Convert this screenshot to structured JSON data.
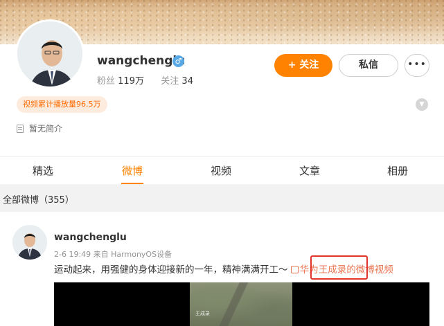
{
  "profile": {
    "username": "wangchenglu",
    "gender_icon": "male-icon",
    "fans_label": "粉丝",
    "fans_count": "119万",
    "following_label": "关注",
    "following_count": "34",
    "follow_button": "+ 关注",
    "message_button": "私信",
    "more_button": "•••",
    "play_count_badge": "视频累计播放量96.5万",
    "bio": "暂无简介"
  },
  "tabs": [
    {
      "label": "精选",
      "active": false
    },
    {
      "label": "微博",
      "active": true
    },
    {
      "label": "视频",
      "active": false
    },
    {
      "label": "文章",
      "active": false
    },
    {
      "label": "相册",
      "active": false
    }
  ],
  "feed": {
    "section_title": "全部微博（355）"
  },
  "post": {
    "username": "wangchenglu",
    "meta": "2-6 19:49  来自 HarmonyOS设备",
    "text": "运动起来，用强健的身体迎接新的一年，精神满满开工～ ",
    "video_link": "华为王成录的微博视频",
    "thumb_caption": "王成录"
  },
  "colors": {
    "accent": "#ff8200",
    "link": "#eb7350",
    "highlight": "#e0332a"
  }
}
